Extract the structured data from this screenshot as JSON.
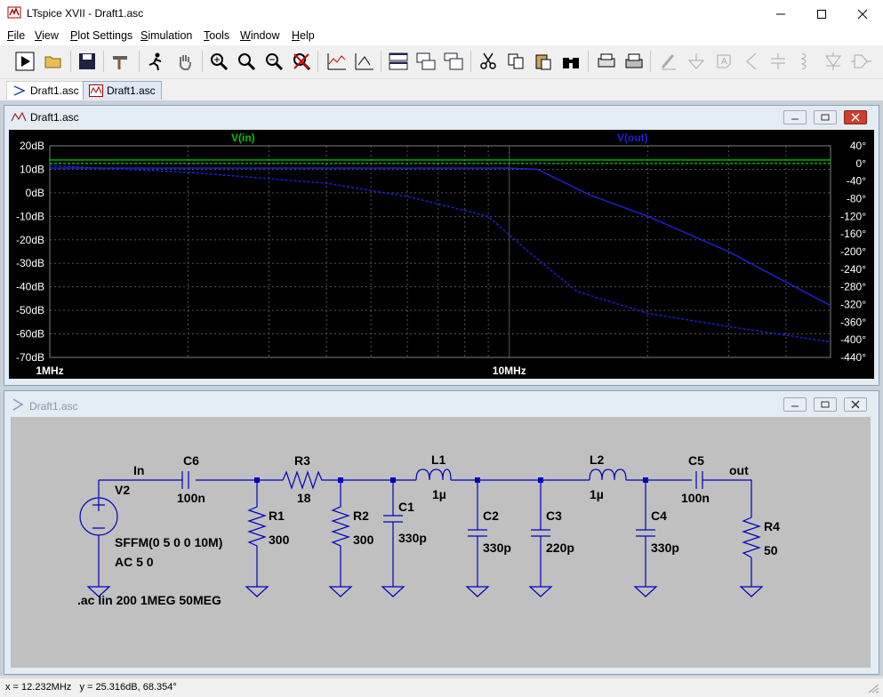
{
  "window": {
    "title": "LTspice XVII - Draft1.asc"
  },
  "menu": [
    {
      "label": "File",
      "accel": "F"
    },
    {
      "label": "View",
      "accel": "V"
    },
    {
      "label": "Plot Settings",
      "accel": "P"
    },
    {
      "label": "Simulation",
      "accel": "S"
    },
    {
      "label": "Tools",
      "accel": "T"
    },
    {
      "label": "Window",
      "accel": "W"
    },
    {
      "label": "Help",
      "accel": "H"
    }
  ],
  "tabs": [
    {
      "label": "Draft1.asc",
      "icon": "schematic-icon"
    },
    {
      "label": "Draft1.asc",
      "icon": "waveform-icon",
      "active": true
    }
  ],
  "waveform_window": {
    "title": "Draft1.asc"
  },
  "schematic_window": {
    "title": "Draft1.asc"
  },
  "plot": {
    "traces": [
      {
        "name": "V(in)",
        "color": "#00c000"
      },
      {
        "name": "V(out)",
        "color": "#2020e0"
      }
    ],
    "left_ticks": [
      "20dB",
      "10dB",
      "0dB",
      "-10dB",
      "-20dB",
      "-30dB",
      "-40dB",
      "-50dB",
      "-60dB",
      "-70dB"
    ],
    "right_ticks": [
      "40°",
      "0°",
      "-40°",
      "-80°",
      "-120°",
      "-160°",
      "-200°",
      "-240°",
      "-280°",
      "-320°",
      "-360°",
      "-400°",
      "-440°"
    ],
    "x_ticks": [
      "1MHz",
      "10MHz"
    ]
  },
  "chart_data": {
    "type": "line",
    "x_scale": "log",
    "xlim_hz": [
      1000000,
      50000000
    ],
    "ylim_db": [
      -70,
      20
    ],
    "ylim_phase_deg": [
      -440,
      40
    ],
    "series": [
      {
        "name": "V(in)",
        "kind": "magnitude_db",
        "x_hz": [
          1000000,
          50000000
        ],
        "y": [
          14,
          14
        ]
      },
      {
        "name": "V(in)",
        "kind": "phase_deg",
        "x_hz": [
          1000000,
          50000000
        ],
        "y": [
          0,
          0
        ]
      },
      {
        "name": "V(out)",
        "kind": "magnitude_db",
        "x_hz": [
          1000000,
          3000000,
          6000000,
          10000000,
          11500000,
          15000000,
          20000000,
          30000000,
          40000000,
          50000000
        ],
        "y": [
          10.5,
          10.5,
          10.5,
          10.5,
          10,
          -1,
          -10,
          -25,
          -38,
          -48
        ]
      },
      {
        "name": "V(out)",
        "kind": "phase_deg",
        "x_hz": [
          1000000,
          2000000,
          4000000,
          6000000,
          9000000,
          11000000,
          14000000,
          20000000,
          30000000,
          50000000
        ],
        "y": [
          -5,
          -20,
          -45,
          -75,
          -120,
          -200,
          -290,
          -340,
          -370,
          -405
        ]
      }
    ]
  },
  "schematic": {
    "net_labels": [
      "In",
      "out"
    ],
    "components": [
      {
        "ref": "V2",
        "value": "SFFM(0 5 0 0 10M)",
        "value2": "AC 5 0"
      },
      {
        "ref": "C6",
        "value": "100n"
      },
      {
        "ref": "R1",
        "value": "300"
      },
      {
        "ref": "R3",
        "value": "18"
      },
      {
        "ref": "R2",
        "value": "300"
      },
      {
        "ref": "C1",
        "value": "330p"
      },
      {
        "ref": "L1",
        "value": "1µ"
      },
      {
        "ref": "C2",
        "value": "330p"
      },
      {
        "ref": "C3",
        "value": "220p"
      },
      {
        "ref": "L2",
        "value": "1µ"
      },
      {
        "ref": "C4",
        "value": "330p"
      },
      {
        "ref": "C5",
        "value": "100n"
      },
      {
        "ref": "R4",
        "value": "50"
      }
    ],
    "directive": ".ac lin 200 1MEG 50MEG"
  },
  "status": {
    "text": "x = 12.232MHz   y = 25.316dB, 68.354°"
  },
  "colors": {
    "plot_bg": "#000000",
    "grid": "#555555",
    "schematic_bg": "#c0c0c0",
    "wire": "#0000c0",
    "vin": "#00c000",
    "vout": "#2020e0"
  }
}
